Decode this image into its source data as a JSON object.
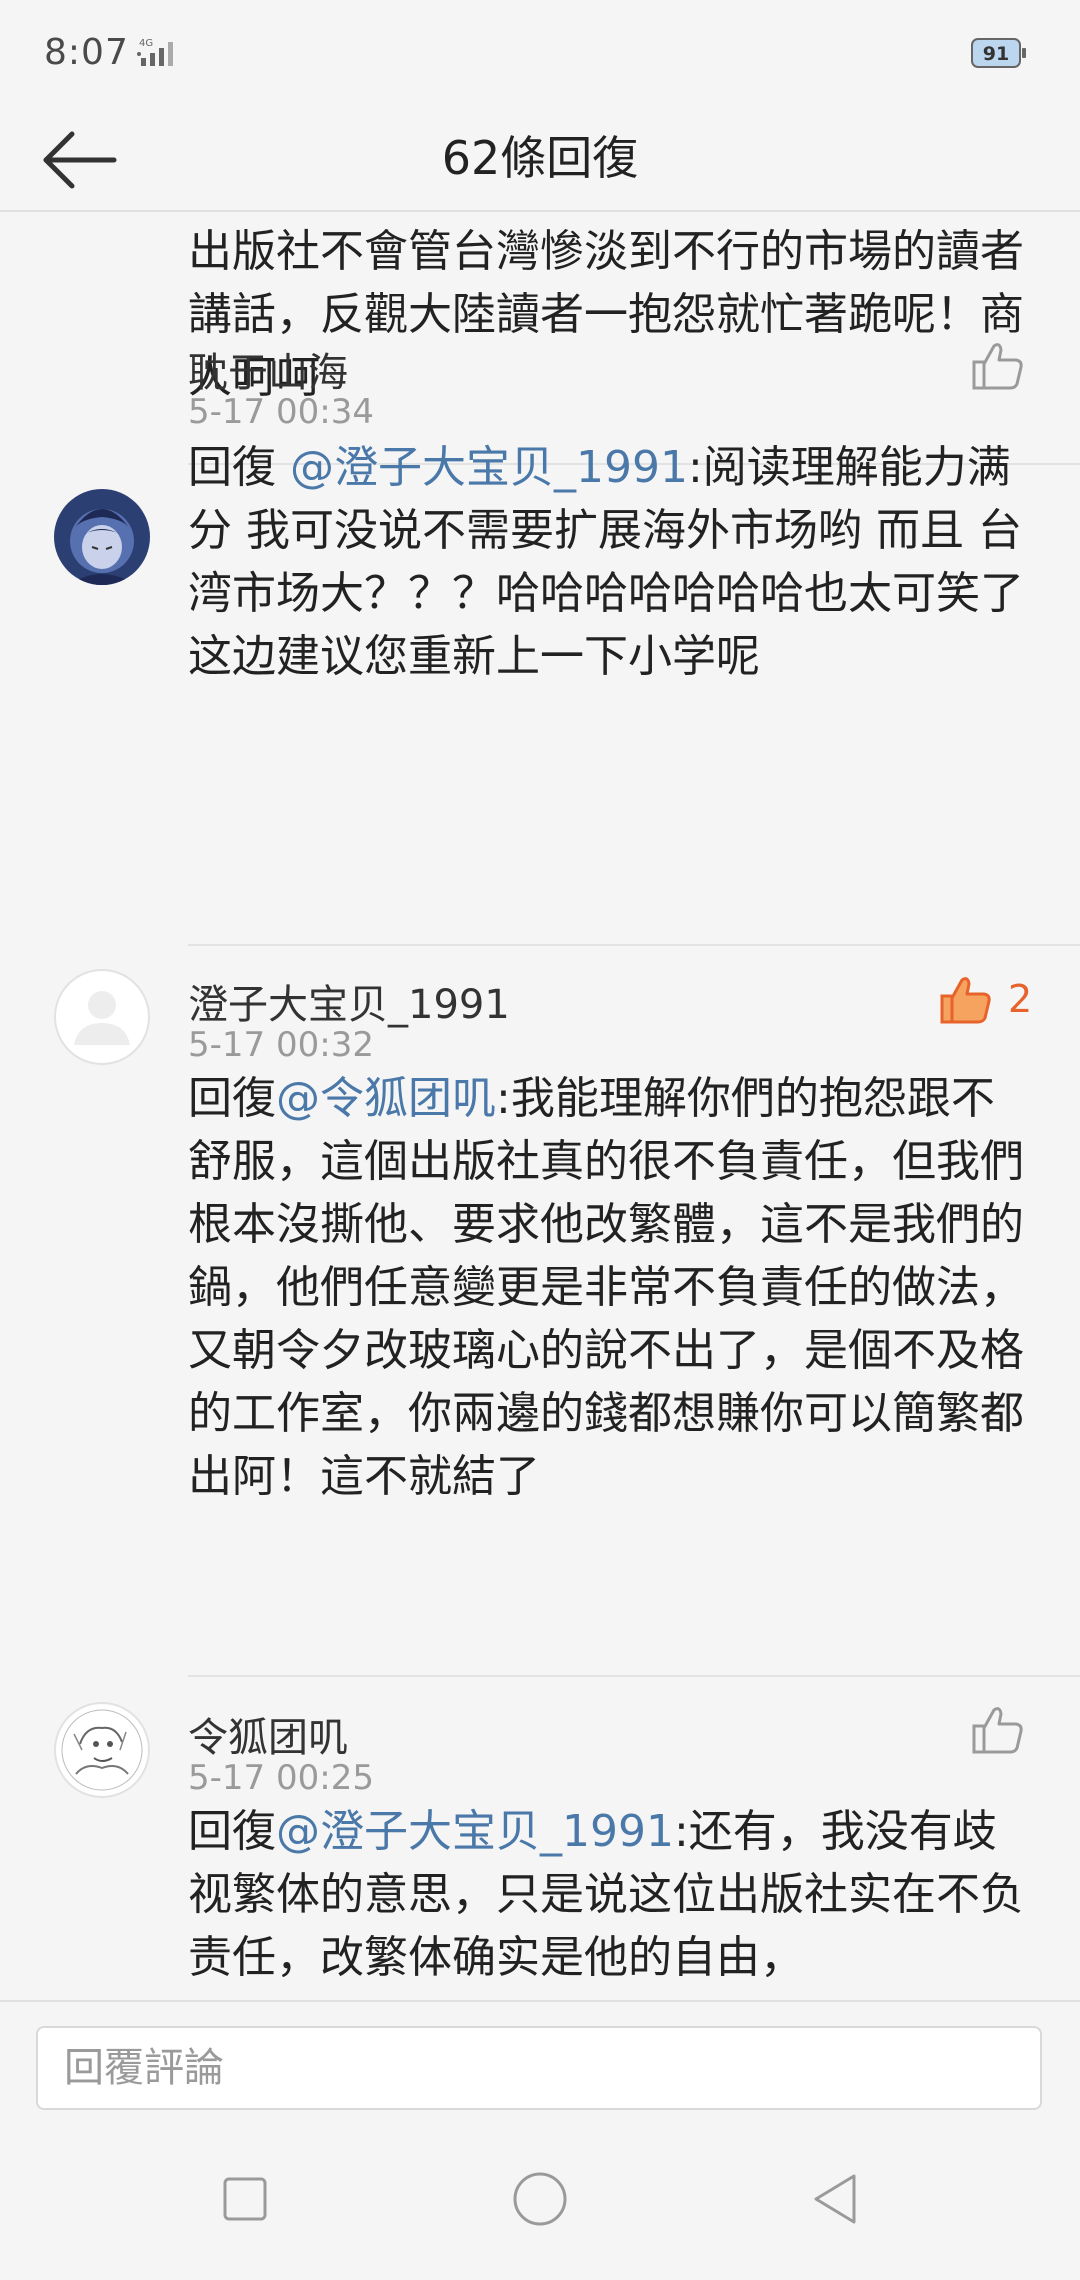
{
  "status_bar": {
    "time": "8:07",
    "network": "4G",
    "battery": "91"
  },
  "header": {
    "title": "62條回復"
  },
  "comments": [
    {
      "text": "出版社不會管台灣慘淡到不行的市場的讀者講話，反觀大陸讀者一抱怨就忙著跪呢！商人呵呵"
    },
    {
      "username": "耽于山海",
      "time": "5-17 00:34",
      "reply_prefix": "回復 ",
      "mention": "@澄子大宝贝_1991",
      "body": ":阅读理解能力满分 我可没说不需要扩展海外市场哟 而且 台湾市场大？？？哈哈哈哈哈哈哈也太可笑了 这边建议您重新上一下小学呢"
    },
    {
      "username": "澄子大宝贝_1991",
      "time": "5-17 00:32",
      "likes": "2",
      "reply_prefix": "回復",
      "mention": "@令狐团叽",
      "body": ":我能理解你們的抱怨跟不舒服，這個出版社真的很不負責任，但我們根本沒撕他、要求他改繁體，這不是我們的鍋，他們任意變更是非常不負責任的做法，又朝令夕改玻璃心的說不出了，是個不及格的工作室，你兩邊的錢都想賺你可以簡繁都出阿！這不就結了"
    },
    {
      "username": "令狐团叽",
      "time": "5-17 00:25",
      "reply_prefix": "回復",
      "mention": "@澄子大宝贝_1991",
      "body": ":还有，我没有歧视繁体的意思，只是说这位出版社实在不负责任，改繁体确实是他的自由，"
    }
  ],
  "reply_input": {
    "placeholder": "回覆評論"
  },
  "colors": {
    "mention": "#4a78a8",
    "liked": "#e8632c",
    "background": "#f5f5f5"
  },
  "icons": {
    "back": "arrow-left-icon",
    "like": "thumbs-up-icon",
    "nav_recent": "square-icon",
    "nav_home": "circle-icon",
    "nav_back": "triangle-icon"
  }
}
